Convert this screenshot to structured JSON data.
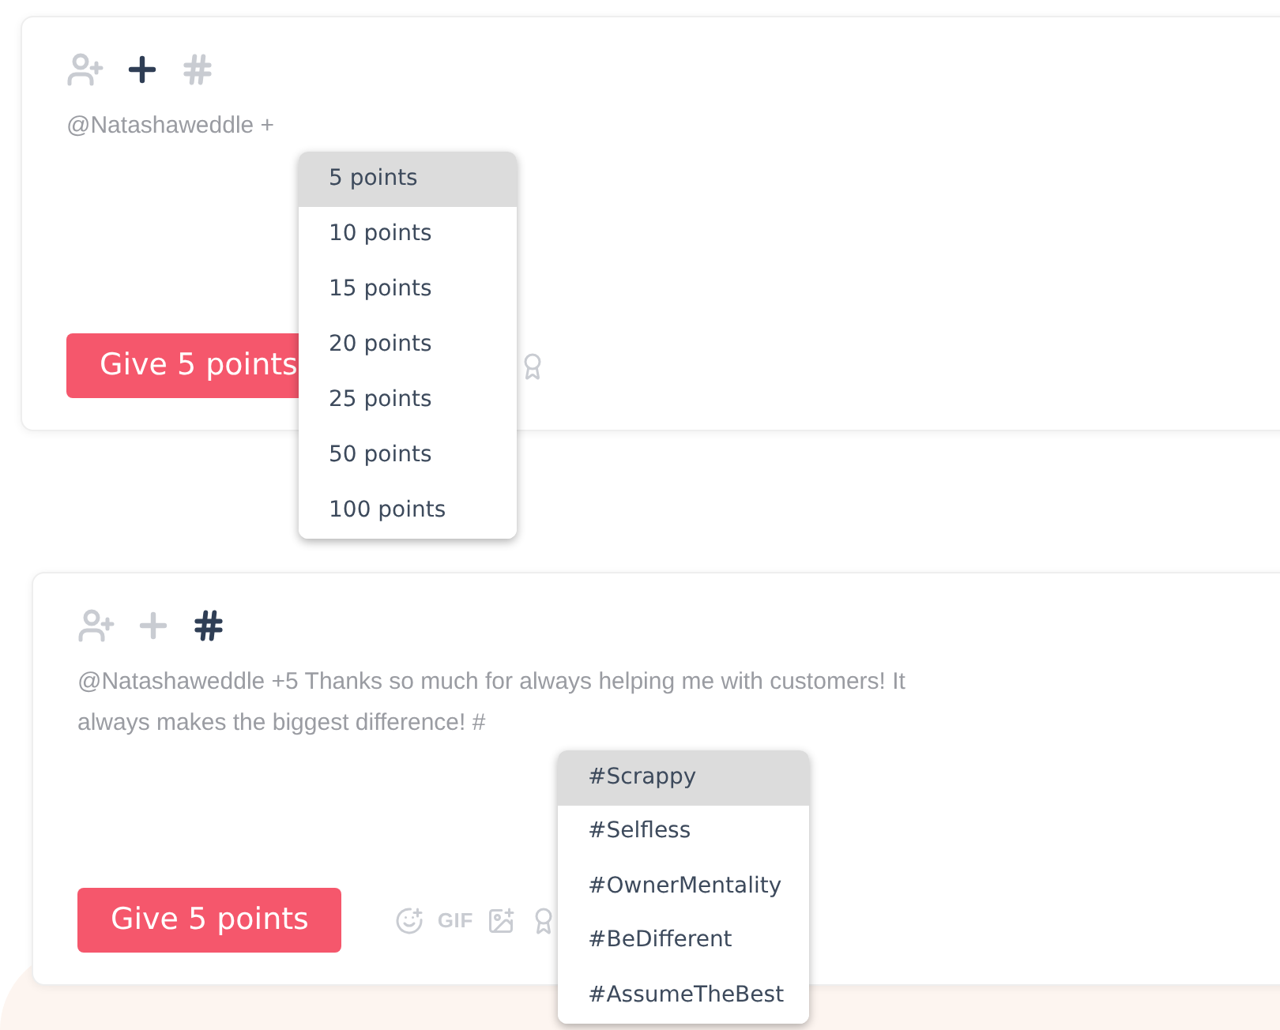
{
  "composers": [
    {
      "toolbar": [
        {
          "kind": "person",
          "active": false
        },
        {
          "kind": "plus",
          "active": true
        },
        {
          "kind": "hash",
          "active": false
        }
      ],
      "text_lines": [
        "@Natashaweddle +"
      ],
      "submit": "Give 5 points",
      "tools": [
        {
          "kind": "award"
        }
      ],
      "menu": {
        "kind": "points",
        "items": [
          {
            "label": "5 points",
            "selected": true
          },
          {
            "label": "10 points",
            "selected": false
          },
          {
            "label": "15 points",
            "selected": false
          },
          {
            "label": "20 points",
            "selected": false
          },
          {
            "label": "25 points",
            "selected": false
          },
          {
            "label": "50 points",
            "selected": false
          },
          {
            "label": "100 points",
            "selected": false
          }
        ]
      }
    },
    {
      "toolbar": [
        {
          "kind": "person",
          "active": false
        },
        {
          "kind": "plus",
          "active": false
        },
        {
          "kind": "hash",
          "active": true
        }
      ],
      "text_lines": [
        "@Natashaweddle +5 Thanks so much for always helping me with customers! It",
        "always makes the biggest difference! #"
      ],
      "submit": "Give 5 points",
      "tools": [
        {
          "kind": "emoji"
        },
        {
          "kind": "gif",
          "label": "GIF"
        },
        {
          "kind": "image"
        },
        {
          "kind": "award"
        }
      ],
      "menu": {
        "kind": "hashtags",
        "items": [
          {
            "label": "#Scrappy",
            "selected": true
          },
          {
            "label": "#Selfless",
            "selected": false
          },
          {
            "label": "#OwnerMentality",
            "selected": false
          },
          {
            "label": "#BeDifferent",
            "selected": false
          },
          {
            "label": "#AssumeTheBest",
            "selected": false
          }
        ]
      }
    }
  ]
}
